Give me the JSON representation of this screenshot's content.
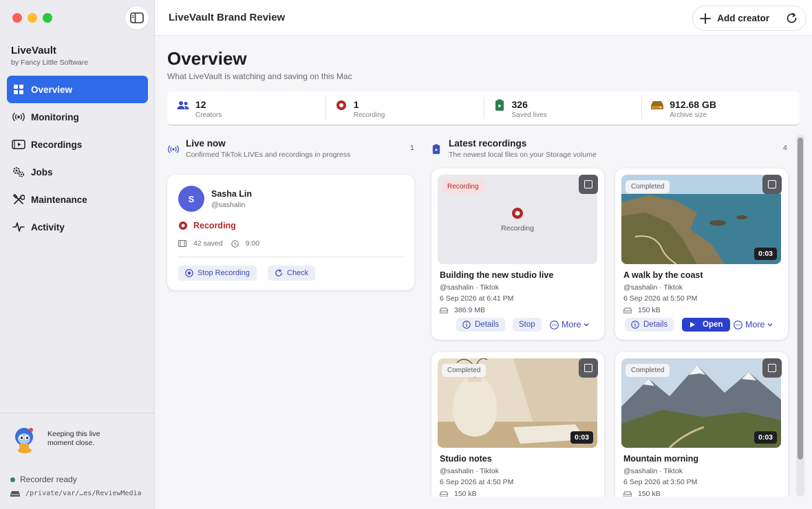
{
  "app": {
    "name": "LiveVault",
    "subtitle": "by Fancy Little Software",
    "window_title": "LiveVault Brand Review"
  },
  "sidebar": {
    "items": [
      {
        "label": "Overview",
        "icon": "grid-icon",
        "active": true
      },
      {
        "label": "Monitoring",
        "icon": "broadcast-icon"
      },
      {
        "label": "Recordings",
        "icon": "play-rectangle-icon"
      },
      {
        "label": "Jobs",
        "icon": "gears-icon"
      },
      {
        "label": "Maintenance",
        "icon": "wrench-screwdriver-icon"
      },
      {
        "label": "Activity",
        "icon": "waveform-icon"
      }
    ],
    "mascot_text": "Keeping this live moment close.",
    "status": "Recorder ready",
    "storage_path": "/private/var/…es/ReviewMedia"
  },
  "toolbar": {
    "add_creator_label": "Add creator"
  },
  "overview": {
    "title": "Overview",
    "subtitle": "What LiveVault is watching and saving on this Mac"
  },
  "stats": [
    {
      "value": "12",
      "label": "Creators",
      "icon": "people-icon"
    },
    {
      "value": "1",
      "label": "Recording",
      "icon": "record-icon"
    },
    {
      "value": "326",
      "label": "Saved lives",
      "icon": "saved-video-icon"
    },
    {
      "value": "912.68 GB",
      "label": "Archive size",
      "icon": "archive-drive-icon"
    }
  ],
  "live_now": {
    "title": "Live now",
    "subtitle": "Confirmed TikTok LIVEs and recordings in progress",
    "count": "1",
    "card": {
      "avatar_initial": "S",
      "name": "Sasha Lin",
      "handle": "@sashalin",
      "status": "Recording",
      "saved": "42 saved",
      "duration": "9:00",
      "stop_label": "Stop Recording",
      "check_label": "Check"
    }
  },
  "latest": {
    "title": "Latest recordings",
    "subtitle": "The newest local files on your Storage volume",
    "count": "4",
    "cards": [
      {
        "badge": "Recording",
        "thumb_label": "Recording",
        "title": "Building the new studio live",
        "source": "@sashalin · Tiktok",
        "date": "6 Sep 2026 at 6:41 PM",
        "size": "386.9 MB",
        "details": "Details",
        "primary": "Stop",
        "more": "More"
      },
      {
        "badge": "Completed",
        "duration": "0:03",
        "title": "A walk by the coast",
        "source": "@sashalin · Tiktok",
        "date": "6 Sep 2026 at 5:50 PM",
        "size": "150 kB",
        "details": "Details",
        "primary": "Open",
        "more": "More"
      },
      {
        "badge": "Completed",
        "duration": "0:03",
        "title": "Studio notes",
        "source": "@sashalin · Tiktok",
        "date": "6 Sep 2026 at 4:50 PM",
        "size": "150 kB"
      },
      {
        "badge": "Completed",
        "duration": "0:03",
        "title": "Mountain morning",
        "source": "@sashalin · Tiktok",
        "date": "6 Sep 2026 at 3:50 PM",
        "size": "150 kB"
      }
    ]
  },
  "colors": {
    "accent": "#2f6ae8",
    "recording_red": "#b32828",
    "ready_green": "#2e8b57",
    "button_blue": "#2d3fce"
  }
}
